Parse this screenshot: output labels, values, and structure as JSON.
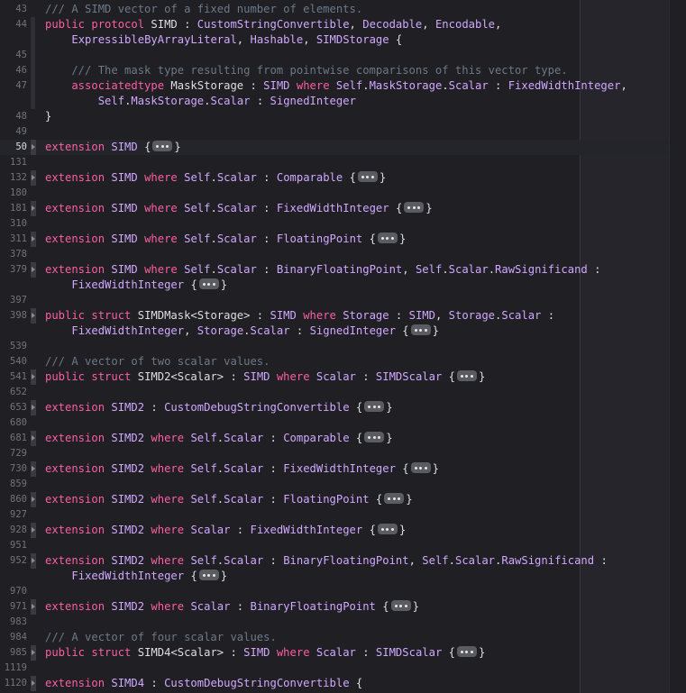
{
  "editor": {
    "language": "swift",
    "current_line": "50",
    "colors": {
      "background": "#1f1f24",
      "keyword": "#fc5fa3",
      "type": "#5dd8ff",
      "protocol": "#d0a8ff",
      "comment": "#6c7986",
      "plain": "#dfdfe0",
      "line_number": "#747478"
    }
  },
  "lines": [
    {
      "n": "43",
      "tokens": [
        [
          "cm",
          "/// A SIMD vector of a fixed number of elements."
        ]
      ]
    },
    {
      "n": "44",
      "tokens": [
        [
          "kw",
          "public protocol "
        ],
        [
          "pl",
          "SIMD : "
        ],
        [
          "tp",
          "CustomStringConvertible"
        ],
        [
          "pl",
          ", "
        ],
        [
          "tp",
          "Decodable"
        ],
        [
          "pl",
          ", "
        ],
        [
          "tp",
          "Encodable"
        ],
        [
          "pl",
          ","
        ]
      ]
    },
    {
      "n": "",
      "tokens": [
        [
          "pl",
          "    "
        ],
        [
          "tp",
          "ExpressibleByArrayLiteral"
        ],
        [
          "pl",
          ", "
        ],
        [
          "tp",
          "Hashable"
        ],
        [
          "pl",
          ", "
        ],
        [
          "tp",
          "SIMDStorage"
        ],
        [
          "pl",
          " {"
        ]
      ]
    },
    {
      "n": "45",
      "tokens": []
    },
    {
      "n": "46",
      "tokens": [
        [
          "cm",
          "    /// The mask type resulting from pointwise comparisons of this vector type."
        ]
      ]
    },
    {
      "n": "47",
      "tokens": [
        [
          "kw",
          "    associatedtype "
        ],
        [
          "pl",
          "MaskStorage : "
        ],
        [
          "tp",
          "SIMD"
        ],
        [
          "pl",
          " "
        ],
        [
          "kw",
          "where"
        ],
        [
          "pl",
          " "
        ],
        [
          "tp",
          "Self"
        ],
        [
          "pl",
          "."
        ],
        [
          "tp",
          "MaskStorage"
        ],
        [
          "pl",
          "."
        ],
        [
          "tp",
          "Scalar"
        ],
        [
          "pl",
          " : "
        ],
        [
          "tp",
          "FixedWidthInteger"
        ],
        [
          "pl",
          ","
        ]
      ]
    },
    {
      "n": "",
      "tokens": [
        [
          "pl",
          "        "
        ],
        [
          "tp",
          "Self"
        ],
        [
          "pl",
          "."
        ],
        [
          "tp",
          "MaskStorage"
        ],
        [
          "pl",
          "."
        ],
        [
          "tp",
          "Scalar"
        ],
        [
          "pl",
          " : "
        ],
        [
          "tp",
          "SignedInteger"
        ]
      ]
    },
    {
      "n": "48",
      "tokens": [
        [
          "pl",
          "}"
        ]
      ]
    },
    {
      "n": "49",
      "tokens": []
    },
    {
      "n": "50",
      "fold": true,
      "tokens": [
        [
          "kw",
          "extension "
        ],
        [
          "tp",
          "SIMD"
        ],
        [
          "pl",
          " {"
        ],
        [
          "fold",
          ""
        ],
        [
          "pl",
          "}"
        ]
      ]
    },
    {
      "n": "131",
      "tokens": []
    },
    {
      "n": "132",
      "fold": true,
      "tokens": [
        [
          "kw",
          "extension "
        ],
        [
          "tp",
          "SIMD"
        ],
        [
          "pl",
          " "
        ],
        [
          "kw",
          "where"
        ],
        [
          "pl",
          " "
        ],
        [
          "tp",
          "Self"
        ],
        [
          "pl",
          "."
        ],
        [
          "tp",
          "Scalar"
        ],
        [
          "pl",
          " : "
        ],
        [
          "tp",
          "Comparable"
        ],
        [
          "pl",
          " {"
        ],
        [
          "fold",
          ""
        ],
        [
          "pl",
          "}"
        ]
      ]
    },
    {
      "n": "180",
      "tokens": []
    },
    {
      "n": "181",
      "fold": true,
      "tokens": [
        [
          "kw",
          "extension "
        ],
        [
          "tp",
          "SIMD"
        ],
        [
          "pl",
          " "
        ],
        [
          "kw",
          "where"
        ],
        [
          "pl",
          " "
        ],
        [
          "tp",
          "Self"
        ],
        [
          "pl",
          "."
        ],
        [
          "tp",
          "Scalar"
        ],
        [
          "pl",
          " : "
        ],
        [
          "tp",
          "FixedWidthInteger"
        ],
        [
          "pl",
          " {"
        ],
        [
          "fold",
          ""
        ],
        [
          "pl",
          "}"
        ]
      ]
    },
    {
      "n": "310",
      "tokens": []
    },
    {
      "n": "311",
      "fold": true,
      "tokens": [
        [
          "kw",
          "extension "
        ],
        [
          "tp",
          "SIMD"
        ],
        [
          "pl",
          " "
        ],
        [
          "kw",
          "where"
        ],
        [
          "pl",
          " "
        ],
        [
          "tp",
          "Self"
        ],
        [
          "pl",
          "."
        ],
        [
          "tp",
          "Scalar"
        ],
        [
          "pl",
          " : "
        ],
        [
          "tp",
          "FloatingPoint"
        ],
        [
          "pl",
          " {"
        ],
        [
          "fold",
          ""
        ],
        [
          "pl",
          "}"
        ]
      ]
    },
    {
      "n": "378",
      "tokens": []
    },
    {
      "n": "379",
      "fold": true,
      "tokens": [
        [
          "kw",
          "extension "
        ],
        [
          "tp",
          "SIMD"
        ],
        [
          "pl",
          " "
        ],
        [
          "kw",
          "where"
        ],
        [
          "pl",
          " "
        ],
        [
          "tp",
          "Self"
        ],
        [
          "pl",
          "."
        ],
        [
          "tp",
          "Scalar"
        ],
        [
          "pl",
          " : "
        ],
        [
          "tp",
          "BinaryFloatingPoint"
        ],
        [
          "pl",
          ", "
        ],
        [
          "tp",
          "Self"
        ],
        [
          "pl",
          "."
        ],
        [
          "tp",
          "Scalar"
        ],
        [
          "pl",
          "."
        ],
        [
          "tp",
          "RawSignificand"
        ],
        [
          "pl",
          " :"
        ]
      ]
    },
    {
      "n": "",
      "tokens": [
        [
          "pl",
          "    "
        ],
        [
          "tp",
          "FixedWidthInteger"
        ],
        [
          "pl",
          " {"
        ],
        [
          "fold",
          ""
        ],
        [
          "pl",
          "}"
        ]
      ]
    },
    {
      "n": "397",
      "tokens": []
    },
    {
      "n": "398",
      "fold": true,
      "tokens": [
        [
          "kw",
          "public struct "
        ],
        [
          "pl",
          "SIMDMask<Storage> : "
        ],
        [
          "tp",
          "SIMD"
        ],
        [
          "pl",
          " "
        ],
        [
          "kw",
          "where"
        ],
        [
          "pl",
          " "
        ],
        [
          "tp",
          "Storage"
        ],
        [
          "pl",
          " : "
        ],
        [
          "tp",
          "SIMD"
        ],
        [
          "pl",
          ", "
        ],
        [
          "tp",
          "Storage"
        ],
        [
          "pl",
          "."
        ],
        [
          "tp",
          "Scalar"
        ],
        [
          "pl",
          " :"
        ]
      ]
    },
    {
      "n": "",
      "tokens": [
        [
          "pl",
          "    "
        ],
        [
          "tp",
          "FixedWidthInteger"
        ],
        [
          "pl",
          ", "
        ],
        [
          "tp",
          "Storage"
        ],
        [
          "pl",
          "."
        ],
        [
          "tp",
          "Scalar"
        ],
        [
          "pl",
          " : "
        ],
        [
          "tp",
          "SignedInteger"
        ],
        [
          "pl",
          " {"
        ],
        [
          "fold",
          ""
        ],
        [
          "pl",
          "}"
        ]
      ]
    },
    {
      "n": "539",
      "tokens": []
    },
    {
      "n": "540",
      "tokens": [
        [
          "cm",
          "/// A vector of two scalar values."
        ]
      ]
    },
    {
      "n": "541",
      "fold": true,
      "tokens": [
        [
          "kw",
          "public struct "
        ],
        [
          "pl",
          "SIMD2<Scalar> : "
        ],
        [
          "tp",
          "SIMD"
        ],
        [
          "pl",
          " "
        ],
        [
          "kw",
          "where"
        ],
        [
          "pl",
          " "
        ],
        [
          "tp",
          "Scalar"
        ],
        [
          "pl",
          " : "
        ],
        [
          "tp",
          "SIMDScalar"
        ],
        [
          "pl",
          " {"
        ],
        [
          "fold",
          ""
        ],
        [
          "pl",
          "}"
        ]
      ]
    },
    {
      "n": "652",
      "tokens": []
    },
    {
      "n": "653",
      "fold": true,
      "tokens": [
        [
          "kw",
          "extension "
        ],
        [
          "tp",
          "SIMD2"
        ],
        [
          "pl",
          " : "
        ],
        [
          "tp",
          "CustomDebugStringConvertible"
        ],
        [
          "pl",
          " {"
        ],
        [
          "fold",
          ""
        ],
        [
          "pl",
          "}"
        ]
      ]
    },
    {
      "n": "680",
      "tokens": []
    },
    {
      "n": "681",
      "fold": true,
      "tokens": [
        [
          "kw",
          "extension "
        ],
        [
          "tp",
          "SIMD2"
        ],
        [
          "pl",
          " "
        ],
        [
          "kw",
          "where"
        ],
        [
          "pl",
          " "
        ],
        [
          "tp",
          "Self"
        ],
        [
          "pl",
          "."
        ],
        [
          "tp",
          "Scalar"
        ],
        [
          "pl",
          " : "
        ],
        [
          "tp",
          "Comparable"
        ],
        [
          "pl",
          " {"
        ],
        [
          "fold",
          ""
        ],
        [
          "pl",
          "}"
        ]
      ]
    },
    {
      "n": "729",
      "tokens": []
    },
    {
      "n": "730",
      "fold": true,
      "tokens": [
        [
          "kw",
          "extension "
        ],
        [
          "tp",
          "SIMD2"
        ],
        [
          "pl",
          " "
        ],
        [
          "kw",
          "where"
        ],
        [
          "pl",
          " "
        ],
        [
          "tp",
          "Self"
        ],
        [
          "pl",
          "."
        ],
        [
          "tp",
          "Scalar"
        ],
        [
          "pl",
          " : "
        ],
        [
          "tp",
          "FixedWidthInteger"
        ],
        [
          "pl",
          " {"
        ],
        [
          "fold",
          ""
        ],
        [
          "pl",
          "}"
        ]
      ]
    },
    {
      "n": "859",
      "tokens": []
    },
    {
      "n": "860",
      "fold": true,
      "tokens": [
        [
          "kw",
          "extension "
        ],
        [
          "tp",
          "SIMD2"
        ],
        [
          "pl",
          " "
        ],
        [
          "kw",
          "where"
        ],
        [
          "pl",
          " "
        ],
        [
          "tp",
          "Self"
        ],
        [
          "pl",
          "."
        ],
        [
          "tp",
          "Scalar"
        ],
        [
          "pl",
          " : "
        ],
        [
          "tp",
          "FloatingPoint"
        ],
        [
          "pl",
          " {"
        ],
        [
          "fold",
          ""
        ],
        [
          "pl",
          "}"
        ]
      ]
    },
    {
      "n": "927",
      "tokens": []
    },
    {
      "n": "928",
      "fold": true,
      "tokens": [
        [
          "kw",
          "extension "
        ],
        [
          "tp",
          "SIMD2"
        ],
        [
          "pl",
          " "
        ],
        [
          "kw",
          "where"
        ],
        [
          "pl",
          " "
        ],
        [
          "tp",
          "Scalar"
        ],
        [
          "pl",
          " : "
        ],
        [
          "tp",
          "FixedWidthInteger"
        ],
        [
          "pl",
          " {"
        ],
        [
          "fold",
          ""
        ],
        [
          "pl",
          "}"
        ]
      ]
    },
    {
      "n": "951",
      "tokens": []
    },
    {
      "n": "952",
      "fold": true,
      "tokens": [
        [
          "kw",
          "extension "
        ],
        [
          "tp",
          "SIMD2"
        ],
        [
          "pl",
          " "
        ],
        [
          "kw",
          "where"
        ],
        [
          "pl",
          " "
        ],
        [
          "tp",
          "Self"
        ],
        [
          "pl",
          "."
        ],
        [
          "tp",
          "Scalar"
        ],
        [
          "pl",
          " : "
        ],
        [
          "tp",
          "BinaryFloatingPoint"
        ],
        [
          "pl",
          ", "
        ],
        [
          "tp",
          "Self"
        ],
        [
          "pl",
          "."
        ],
        [
          "tp",
          "Scalar"
        ],
        [
          "pl",
          "."
        ],
        [
          "tp",
          "RawSignificand"
        ],
        [
          "pl",
          " :"
        ]
      ]
    },
    {
      "n": "",
      "tokens": [
        [
          "pl",
          "    "
        ],
        [
          "tp",
          "FixedWidthInteger"
        ],
        [
          "pl",
          " {"
        ],
        [
          "fold",
          ""
        ],
        [
          "pl",
          "}"
        ]
      ]
    },
    {
      "n": "970",
      "tokens": []
    },
    {
      "n": "971",
      "fold": true,
      "tokens": [
        [
          "kw",
          "extension "
        ],
        [
          "tp",
          "SIMD2"
        ],
        [
          "pl",
          " "
        ],
        [
          "kw",
          "where"
        ],
        [
          "pl",
          " "
        ],
        [
          "tp",
          "Scalar"
        ],
        [
          "pl",
          " : "
        ],
        [
          "tp",
          "BinaryFloatingPoint"
        ],
        [
          "pl",
          " {"
        ],
        [
          "fold",
          ""
        ],
        [
          "pl",
          "}"
        ]
      ]
    },
    {
      "n": "983",
      "tokens": []
    },
    {
      "n": "984",
      "tokens": [
        [
          "cm",
          "/// A vector of four scalar values."
        ]
      ]
    },
    {
      "n": "985",
      "fold": true,
      "tokens": [
        [
          "kw",
          "public struct "
        ],
        [
          "pl",
          "SIMD4<Scalar> : "
        ],
        [
          "tp",
          "SIMD"
        ],
        [
          "pl",
          " "
        ],
        [
          "kw",
          "where"
        ],
        [
          "pl",
          " "
        ],
        [
          "tp",
          "Scalar"
        ],
        [
          "pl",
          " : "
        ],
        [
          "tp",
          "SIMDScalar"
        ],
        [
          "pl",
          " {"
        ],
        [
          "fold",
          ""
        ],
        [
          "pl",
          "}"
        ]
      ]
    },
    {
      "n": "1119",
      "tokens": []
    },
    {
      "n": "1120",
      "fold": true,
      "tokens": [
        [
          "kw",
          "extension "
        ],
        [
          "tp",
          "SIMD4"
        ],
        [
          "pl",
          " : "
        ],
        [
          "tp",
          "CustomDebugStringConvertible"
        ],
        [
          "pl",
          " {"
        ]
      ]
    }
  ]
}
